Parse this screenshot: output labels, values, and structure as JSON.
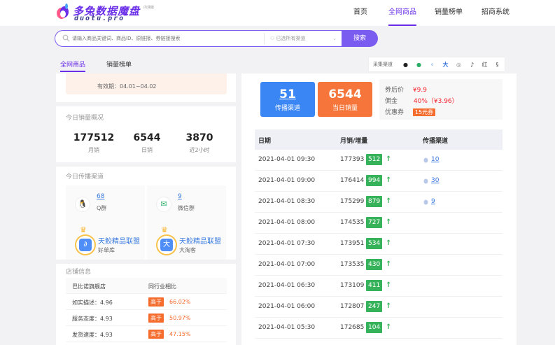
{
  "header": {
    "logo_title": "多兔数据魔盘",
    "logo_domain": "duotu.pro",
    "logo_badge": "内测版",
    "nav": [
      "首页",
      "全网商品",
      "销量榜单",
      "招商系统"
    ],
    "active_nav": "全网商品",
    "accent_color": "#6a2ee8"
  },
  "search": {
    "placeholder": "请输入商品关键词、商品ID、原链接、券链接搜索",
    "channel_select": "已选所有渠道",
    "button_label": "搜索"
  },
  "tabs": {
    "items": [
      "全网商品",
      "销量榜单"
    ],
    "active": "全网商品",
    "channel_bar_label": "采集渠道",
    "channel_icons": [
      "qq-icon",
      "wechat-icon",
      "weibo-icon",
      "da-icon",
      "pinduoduo-icon",
      "tiktok-icon",
      "honghu-icon",
      "other-icon"
    ]
  },
  "left": {
    "validity": "有效期：04.01~04.02",
    "today_sales_title": "今日销量概况",
    "stats": [
      {
        "value": "177512",
        "label": "月销"
      },
      {
        "value": "6544",
        "label": "日销"
      },
      {
        "value": "3870",
        "label": "近2小时"
      }
    ],
    "channels_title": "今日传播渠道",
    "channels": [
      {
        "count": "68",
        "name": "Q群",
        "icon": "qq-icon"
      },
      {
        "count": "9",
        "name": "微信群",
        "icon": "wechat-icon"
      }
    ],
    "leagues": [
      {
        "title": "天鲛精品联盟",
        "sub": "好单库",
        "icon": "haodanku-icon",
        "glyph": "∂"
      },
      {
        "title": "天鲛精品联盟",
        "sub": "大淘客",
        "icon": "dataoke-icon",
        "glyph": "大"
      }
    ],
    "shop_title": "店铺信息",
    "shop_name": "巴比诺旗舰店",
    "shop_compare_label": "同行业相比",
    "shop_rows": [
      {
        "label": "如实描述：4.96",
        "tag": "高于",
        "pct": "66.02%"
      },
      {
        "label": "服务态度：4.93",
        "tag": "高于",
        "pct": "50.97%"
      },
      {
        "label": "发货速度：4.93",
        "tag": "高于",
        "pct": "47.15%"
      }
    ]
  },
  "right": {
    "metrics": [
      {
        "value": "51",
        "label": "传播渠道",
        "color": "#3a86f5"
      },
      {
        "value": "6544",
        "label": "当日销量",
        "color": "#f5753a"
      }
    ],
    "price": {
      "after_coupon_label": "券后价",
      "after_coupon_value": "¥9.9",
      "commission_label": "佣金",
      "commission_value": "40%（¥3.96）",
      "coupon_label": "优惠券",
      "coupon_value": "15元券"
    },
    "table": {
      "headers": [
        "日期",
        "月销/增量",
        "传播渠道"
      ],
      "rows": [
        {
          "date": "2021-04-01 09:30",
          "sales": "177393",
          "delta": "512",
          "channels": "10"
        },
        {
          "date": "2021-04-01 09:00",
          "sales": "176414",
          "delta": "994",
          "channels": "30"
        },
        {
          "date": "2021-04-01 08:30",
          "sales": "175299",
          "delta": "879",
          "channels": "9"
        },
        {
          "date": "2021-04-01 08:00",
          "sales": "174535",
          "delta": "727",
          "channels": ""
        },
        {
          "date": "2021-04-01 07:30",
          "sales": "173951",
          "delta": "534",
          "channels": ""
        },
        {
          "date": "2021-04-01 07:00",
          "sales": "173535",
          "delta": "430",
          "channels": ""
        },
        {
          "date": "2021-04-01 06:30",
          "sales": "173109",
          "delta": "411",
          "channels": ""
        },
        {
          "date": "2021-04-01 06:00",
          "sales": "172807",
          "delta": "247",
          "channels": ""
        },
        {
          "date": "2021-04-01 05:30",
          "sales": "172685",
          "delta": "104",
          "channels": ""
        }
      ],
      "up_arrow": "↑"
    }
  }
}
